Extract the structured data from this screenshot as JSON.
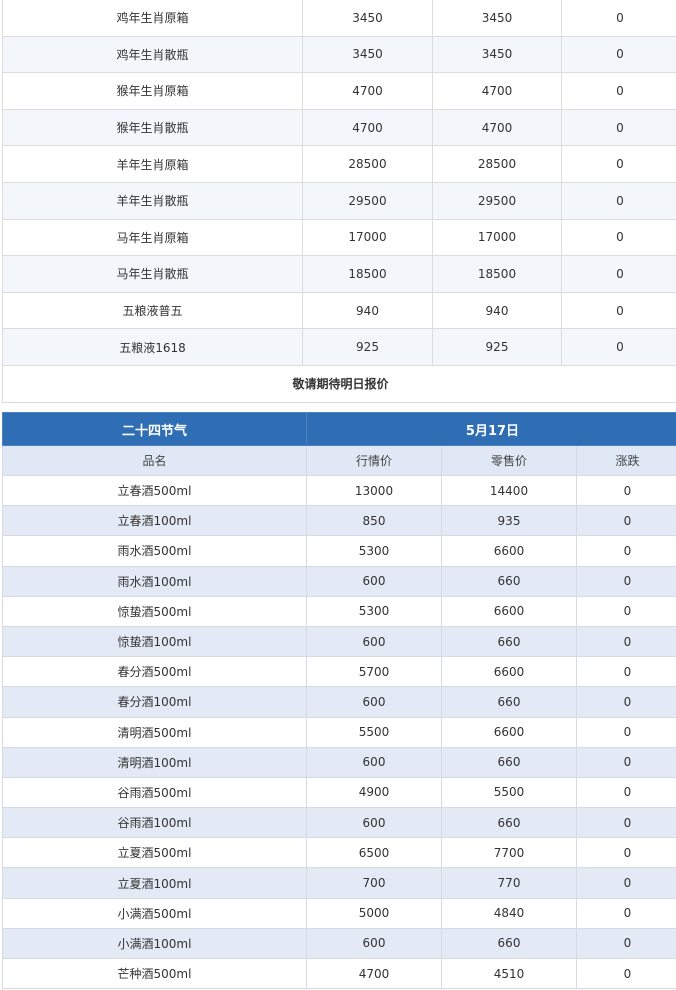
{
  "top_table": {
    "rows": [
      {
        "name": "鸡年生肖原箱",
        "a": "3450",
        "b": "3450",
        "c": "0"
      },
      {
        "name": "鸡年生肖散瓶",
        "a": "3450",
        "b": "3450",
        "c": "0"
      },
      {
        "name": "猴年生肖原箱",
        "a": "4700",
        "b": "4700",
        "c": "0"
      },
      {
        "name": "猴年生肖散瓶",
        "a": "4700",
        "b": "4700",
        "c": "0"
      },
      {
        "name": "羊年生肖原箱",
        "a": "28500",
        "b": "28500",
        "c": "0"
      },
      {
        "name": "羊年生肖散瓶",
        "a": "29500",
        "b": "29500",
        "c": "0"
      },
      {
        "name": "马年生肖原箱",
        "a": "17000",
        "b": "17000",
        "c": "0"
      },
      {
        "name": "马年生肖散瓶",
        "a": "18500",
        "b": "18500",
        "c": "0"
      },
      {
        "name": "五粮液普五",
        "a": "940",
        "b": "940",
        "c": "0"
      },
      {
        "name": "五粮液1618",
        "a": "925",
        "b": "925",
        "c": "0"
      }
    ],
    "note": "敬请期待明日报价"
  },
  "bottom_table": {
    "title": "二十四节气",
    "date": "5月17日",
    "columns": [
      "品名",
      "行情价",
      "零售价",
      "涨跌"
    ],
    "rows": [
      {
        "name": "立春酒500ml",
        "market": "13000",
        "retail": "14400",
        "change": "0"
      },
      {
        "name": "立春酒100ml",
        "market": "850",
        "retail": "935",
        "change": "0"
      },
      {
        "name": "雨水酒500ml",
        "market": "5300",
        "retail": "6600",
        "change": "0"
      },
      {
        "name": "雨水酒100ml",
        "market": "600",
        "retail": "660",
        "change": "0"
      },
      {
        "name": "惊蛰酒500ml",
        "market": "5300",
        "retail": "6600",
        "change": "0"
      },
      {
        "name": "惊蛰酒100ml",
        "market": "600",
        "retail": "660",
        "change": "0"
      },
      {
        "name": "春分酒500ml",
        "market": "5700",
        "retail": "6600",
        "change": "0"
      },
      {
        "name": "春分酒100ml",
        "market": "600",
        "retail": "660",
        "change": "0"
      },
      {
        "name": "清明酒500ml",
        "market": "5500",
        "retail": "6600",
        "change": "0"
      },
      {
        "name": "清明酒100ml",
        "market": "600",
        "retail": "660",
        "change": "0"
      },
      {
        "name": "谷雨酒500ml",
        "market": "4900",
        "retail": "5500",
        "change": "0"
      },
      {
        "name": "谷雨酒100ml",
        "market": "600",
        "retail": "660",
        "change": "0"
      },
      {
        "name": "立夏酒500ml",
        "market": "6500",
        "retail": "7700",
        "change": "0"
      },
      {
        "name": "立夏酒100ml",
        "market": "700",
        "retail": "770",
        "change": "0"
      },
      {
        "name": "小满酒500ml",
        "market": "5000",
        "retail": "4840",
        "change": "0"
      },
      {
        "name": "小满酒100ml",
        "market": "600",
        "retail": "660",
        "change": "0"
      },
      {
        "name": "芒种酒500ml",
        "market": "4700",
        "retail": "4510",
        "change": "0"
      }
    ]
  },
  "colors": {
    "header_blue": "#2f6db5",
    "subheader": "#dfe8f4",
    "stripe": "#e4eaf5"
  }
}
